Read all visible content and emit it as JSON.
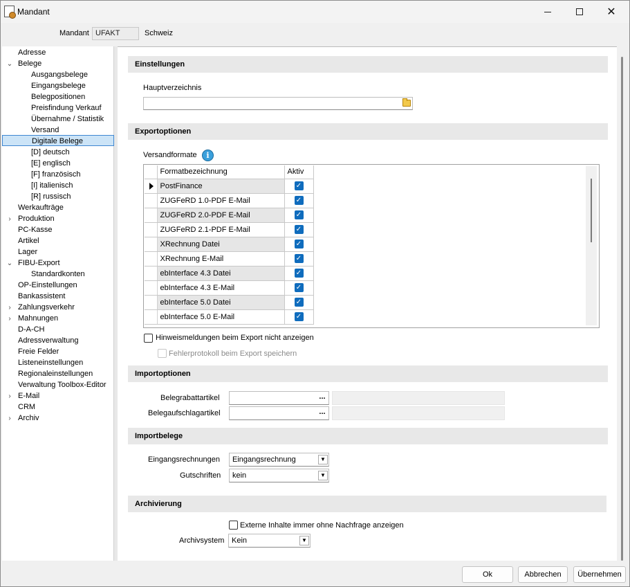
{
  "window": {
    "title": "Mandant"
  },
  "mandant": {
    "label": "Mandant",
    "code": "UFAKT",
    "name": "Schweiz"
  },
  "sidebar": {
    "items": [
      {
        "label": "Adresse"
      },
      {
        "label": "Belege"
      },
      {
        "label": "Ausgangsbelege"
      },
      {
        "label": "Eingangsbelege"
      },
      {
        "label": "Belegpositionen"
      },
      {
        "label": "Preisfindung Verkauf"
      },
      {
        "label": "Übernahme / Statistik"
      },
      {
        "label": "Versand"
      },
      {
        "label": "Digitale Belege"
      },
      {
        "label": "[D]  deutsch"
      },
      {
        "label": "[E]  englisch"
      },
      {
        "label": "[F]  französisch"
      },
      {
        "label": "[I]  italienisch"
      },
      {
        "label": "[R]  russisch"
      },
      {
        "label": "Werkaufträge"
      },
      {
        "label": "Produktion"
      },
      {
        "label": "PC-Kasse"
      },
      {
        "label": "Artikel"
      },
      {
        "label": "Lager"
      },
      {
        "label": "FIBU-Export"
      },
      {
        "label": "Standardkonten"
      },
      {
        "label": "OP-Einstellungen"
      },
      {
        "label": "Bankassistent"
      },
      {
        "label": "Zahlungsverkehr"
      },
      {
        "label": "Mahnungen"
      },
      {
        "label": "D-A-CH"
      },
      {
        "label": "Adressverwaltung"
      },
      {
        "label": "Freie Felder"
      },
      {
        "label": "Listeneinstellungen"
      },
      {
        "label": "Regionaleinstellungen"
      },
      {
        "label": "Verwaltung Toolbox-Editor"
      },
      {
        "label": "E-Mail"
      },
      {
        "label": "CRM"
      },
      {
        "label": "Archiv"
      }
    ]
  },
  "einstellungen": {
    "title": "Einstellungen",
    "hauptverzeichnis_label": "Hauptverzeichnis",
    "hauptverzeichnis_value": ""
  },
  "export": {
    "title": "Exportoptionen",
    "versandformate_label": "Versandformate",
    "columns": {
      "name": "Formatbezeichnung",
      "active": "Aktiv"
    },
    "rows": [
      {
        "name": "PostFinance"
      },
      {
        "name": "ZUGFeRD 1.0-PDF E-Mail"
      },
      {
        "name": "ZUGFeRD 2.0-PDF E-Mail"
      },
      {
        "name": "ZUGFeRD 2.1-PDF E-Mail"
      },
      {
        "name": "XRechnung Datei"
      },
      {
        "name": "XRechnung E-Mail"
      },
      {
        "name": "ebInterface 4.3 Datei"
      },
      {
        "name": "ebInterface 4.3 E-Mail"
      },
      {
        "name": "ebInterface 5.0 Datei"
      },
      {
        "name": "ebInterface 5.0 E-Mail"
      }
    ],
    "hint_checkbox": "Hinweismeldungen beim Export nicht anzeigen",
    "log_checkbox": "Fehlerprotokoll beim Export speichern"
  },
  "import": {
    "title": "Importoptionen",
    "rabatt_label": "Belegrabattartikel",
    "aufschlag_label": "Belegaufschlagartikel",
    "browse": "..."
  },
  "importbelege": {
    "title": "Importbelege",
    "eingang_label": "Eingangsrechnungen",
    "eingang_value": "Eingangsrechnung",
    "gutschrift_label": "Gutschriften",
    "gutschrift_value": "kein"
  },
  "archiv": {
    "title": "Archivierung",
    "checkbox": "Externe Inhalte immer ohne Nachfrage anzeigen",
    "system_label": "Archivsystem",
    "system_value": "Kein"
  },
  "buttons": {
    "ok": "Ok",
    "cancel": "Abbrechen",
    "apply": "Übernehmen"
  },
  "colors": {
    "accent": "#0f6cbd",
    "selection": "#cce4f7",
    "section_bg": "#e8e8e8"
  }
}
